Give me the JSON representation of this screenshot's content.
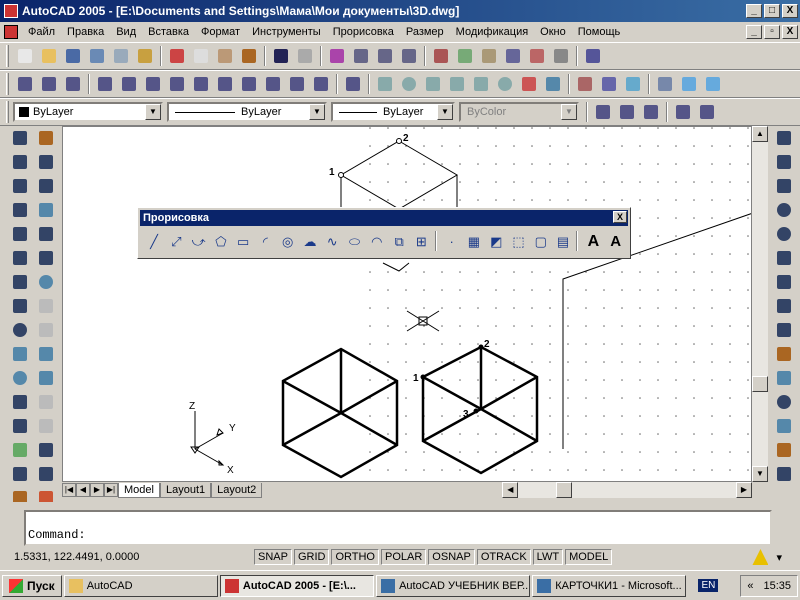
{
  "window": {
    "title": "AutoCAD 2005 - [E:\\Documents and Settings\\Мама\\Мои документы\\3D.dwg]",
    "min": "_",
    "max": "□",
    "close": "X"
  },
  "menu": {
    "items": [
      "Файл",
      "Правка",
      "Вид",
      "Вставка",
      "Формат",
      "Инструменты",
      "Прорисовка",
      "Размер",
      "Модификация",
      "Окно",
      "Помощь"
    ],
    "doc_min": "_",
    "doc_restore": "▫",
    "doc_close": "X"
  },
  "properties": {
    "layer": "ByLayer",
    "linetype": "ByLayer",
    "lineweight": "ByLayer",
    "plotstyle": "ByColor"
  },
  "floating_toolbar": {
    "title": "Прорисовка",
    "close": "X",
    "icons": [
      "line-icon",
      "construction-line-icon",
      "polyline-icon",
      "polygon-icon",
      "rectangle-icon",
      "arc-icon",
      "circle-icon",
      "revision-cloud-icon",
      "spline-icon",
      "ellipse-icon",
      "ellipse-arc-icon",
      "insert-block-icon",
      "make-block-icon",
      "point-icon",
      "hatch-icon",
      "gradient-icon",
      "region-icon",
      "wipeout-icon",
      "table-icon",
      "multiline-text-icon",
      "single-line-text-icon"
    ],
    "glyphs": [
      "╱",
      "⤢",
      "⤻",
      "⬠",
      "▭",
      "◜",
      "◎",
      "☁",
      "∿",
      "⬭",
      "◠",
      "⧉",
      "⊞",
      "·",
      "▦",
      "◩",
      "⬚",
      "▢",
      "▤",
      "A",
      "A"
    ]
  },
  "drawing": {
    "labels": {
      "top_1": "1",
      "top_2": "2",
      "right_1": "1",
      "right_2": "2",
      "right_3": "3"
    },
    "ucs": {
      "z": "Z",
      "y": "Y",
      "x": "X"
    }
  },
  "tabs": {
    "nav": [
      "|◀",
      "◀",
      "▶",
      "▶|"
    ],
    "items": [
      "Model",
      "Layout1",
      "Layout2"
    ],
    "active": "Model"
  },
  "command": {
    "prompt": "Command:"
  },
  "status": {
    "coords": "1.5331,   122.4491, 0.0000",
    "toggles": [
      "SNAP",
      "GRID",
      "ORTHO",
      "POLAR",
      "OSNAP",
      "OTRACK",
      "LWT",
      "MODEL"
    ]
  },
  "taskbar": {
    "start": "Пуск",
    "tasks": [
      "AutoCAD",
      "AutoCAD 2005 - [E:\\...",
      "AutoCAD УЧЕБНИК ВЕР...",
      "КАРТОЧКИ1 - Microsoft..."
    ],
    "active_task": 1,
    "lang": "EN",
    "chevron": "«",
    "clock": "15:35"
  }
}
